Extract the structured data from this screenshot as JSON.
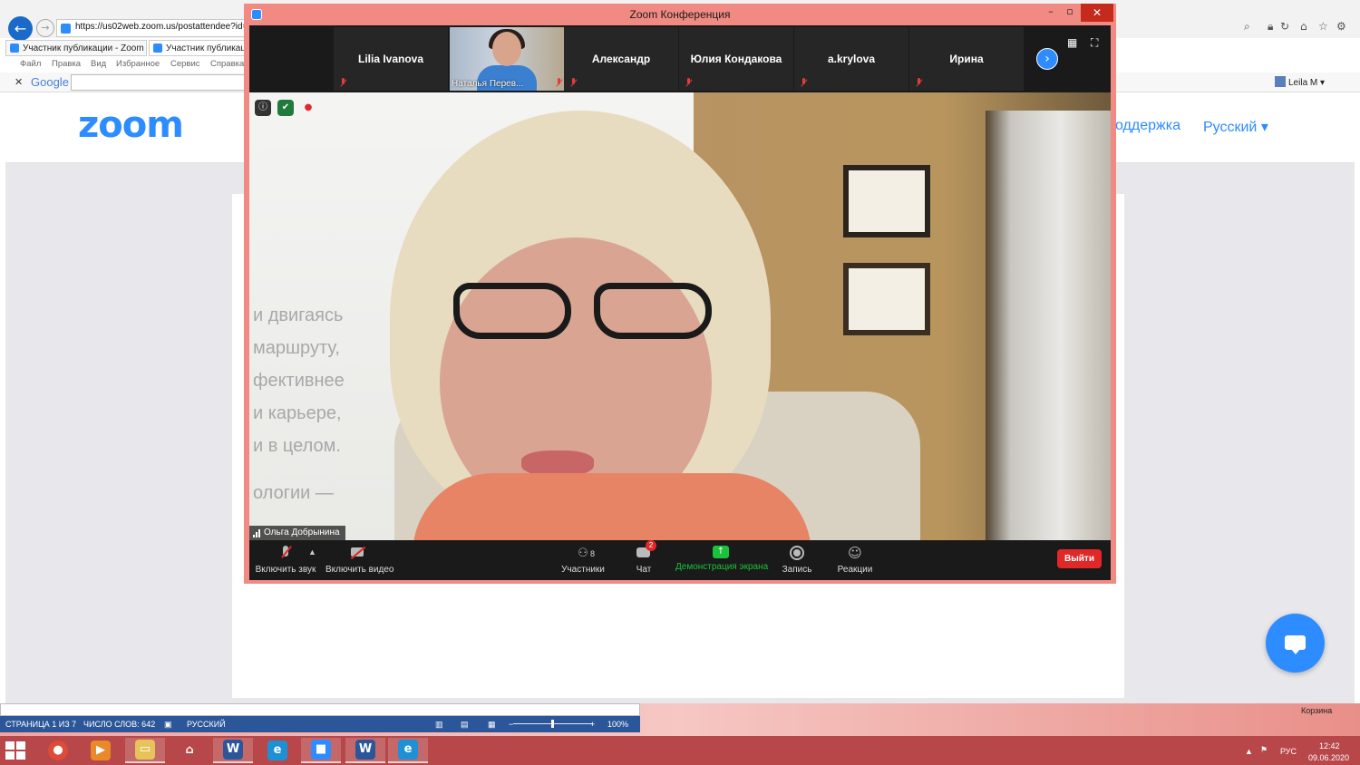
{
  "browser": {
    "url": "https://us02web.zoom.us/postattendee?id=3",
    "tabs": [
      {
        "label": "Участник публикации - Zoom"
      },
      {
        "label": "Участник публикации"
      }
    ],
    "menu": [
      "Файл",
      "Правка",
      "Вид",
      "Избранное",
      "Сервис",
      "Справка"
    ],
    "google_label": "Google",
    "user_label": "Leila M"
  },
  "site": {
    "logo": "zoom",
    "support_label": "оддержка",
    "language_label": "Русский ▾",
    "accent_color": "#2d8cff"
  },
  "zoom_window": {
    "title": "Zoom Конференция",
    "participants_strip": [
      {
        "name": "Lilia Ivanova",
        "muted": true
      },
      {
        "name": "Наталья Перев...",
        "muted": true,
        "has_video": true
      },
      {
        "name": "Александр",
        "muted": true
      },
      {
        "name": "Юлия Кондакова",
        "muted": true
      },
      {
        "name": "a.krylova",
        "muted": true
      },
      {
        "name": "Ирина",
        "muted": true
      }
    ],
    "active_speaker": "Ольга Добрынина",
    "wall_text": [
      "и двигаясь",
      "маршруту,",
      "фективнее",
      "и карьере,",
      "и в целом.",
      "ологии —"
    ],
    "toolbar": {
      "unmute": "Включить звук",
      "start_video": "Включить видео",
      "participants": "Участники",
      "participants_count": "8",
      "chat": "Чат",
      "chat_badge": "2",
      "share_screen": "Демонстрация экрана",
      "record": "Запись",
      "reactions": "Реакции",
      "leave": "Выйти"
    }
  },
  "word_status": {
    "page": "СТРАНИЦА 1 ИЗ 7",
    "words": "ЧИСЛО СЛОВ: 642",
    "language": "РУССКИЙ",
    "zoom": "100%"
  },
  "desktop": {
    "trash_label": "Корзина"
  },
  "taskbar": {
    "language": "РУС",
    "time": "12:42",
    "date": "09.06.2020"
  }
}
